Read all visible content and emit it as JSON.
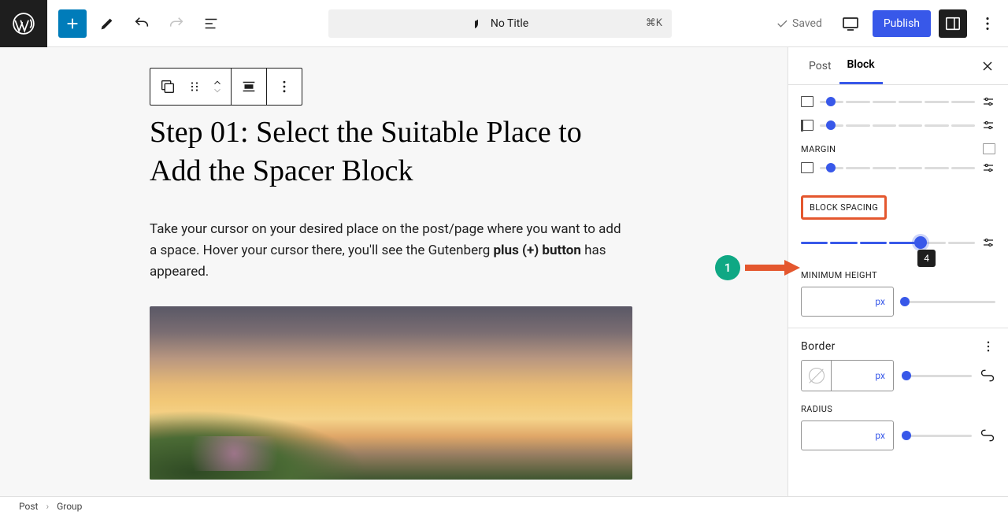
{
  "toolbar": {
    "title": "No Title",
    "kbd": "⌘K",
    "saved": "Saved",
    "publish": "Publish"
  },
  "content": {
    "heading": "Step 01: Select the Suitable Place to Add the Spacer Block",
    "para_before_bold": "Take your cursor on your desired place on the post/page where you want to add a space. Hover your cursor there, you'll see the Gutenberg ",
    "para_bold": "plus (+) button",
    "para_after_bold": " has appeared."
  },
  "sidebar": {
    "tabs": {
      "post": "Post",
      "block": "Block"
    },
    "margin_label": "MARGIN",
    "block_spacing_label": "BLOCK SPACING",
    "block_spacing_value": "4",
    "min_height_label": "MINIMUM HEIGHT",
    "unit_px": "px",
    "border_label": "Border",
    "radius_label": "RADIUS"
  },
  "annotation": {
    "num": "1"
  },
  "breadcrumb": {
    "a": "Post",
    "b": "Group"
  }
}
